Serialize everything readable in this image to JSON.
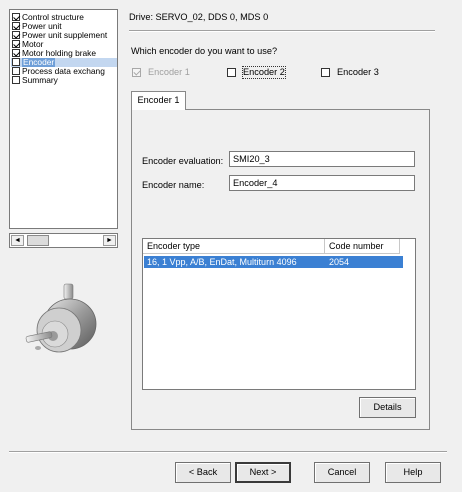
{
  "nav": {
    "items": [
      {
        "label": "Control structure",
        "checked": true
      },
      {
        "label": "Power unit",
        "checked": true
      },
      {
        "label": "Power unit supplement",
        "checked": true
      },
      {
        "label": "Motor",
        "checked": true
      },
      {
        "label": "Motor holding brake",
        "checked": true
      },
      {
        "label": "Encoder",
        "checked": false,
        "selected": true
      },
      {
        "label": "Process data exchang",
        "checked": false
      },
      {
        "label": "Summary",
        "checked": false
      }
    ],
    "scroll_left": "◄",
    "scroll_right": "►"
  },
  "header": {
    "drive_title": "Drive: SERVO_02, DDS 0, MDS 0",
    "question": "Which encoder do you want to use?"
  },
  "encoder_options": [
    {
      "label": "Encoder 1",
      "checked": true,
      "disabled": true
    },
    {
      "label": "Encoder 2",
      "checked": false,
      "focused": true
    },
    {
      "label": "Encoder 3",
      "checked": false
    }
  ],
  "tab": {
    "label": "Encoder 1"
  },
  "form": {
    "evaluation_label": "Encoder evaluation:",
    "evaluation_value": "SMI20_3",
    "name_label": "Encoder name:",
    "name_value": "Encoder_4"
  },
  "table": {
    "columns": [
      "Encoder type",
      "Code number"
    ],
    "rows": [
      {
        "type": "16, 1 Vpp, A/B, EnDat, Multiturn 4096",
        "code": "2054",
        "selected": true
      }
    ]
  },
  "buttons": {
    "details": "Details",
    "back": "< Back",
    "next": "Next >",
    "cancel": "Cancel",
    "help": "Help"
  },
  "colors": {
    "selection": "#3b80d3",
    "window_bg": "#f0f0f0"
  }
}
